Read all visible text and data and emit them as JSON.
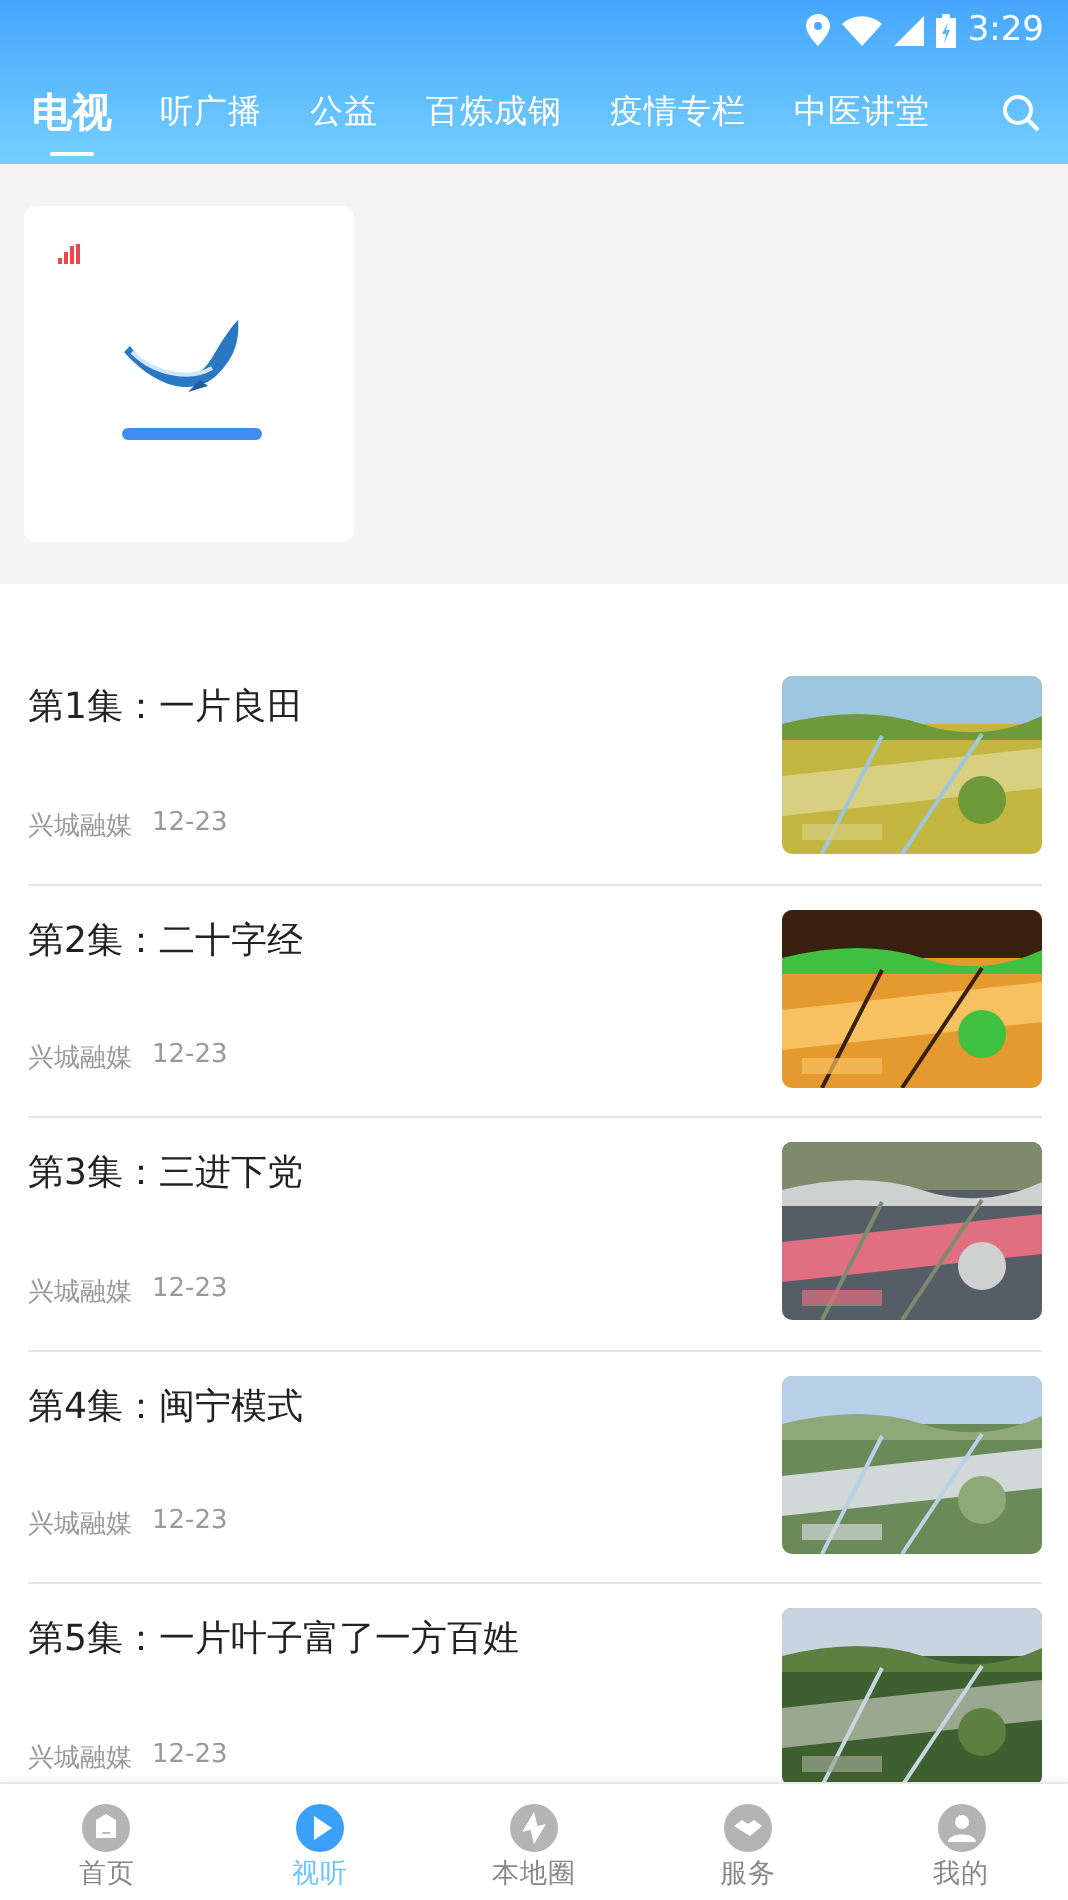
{
  "status_bar": {
    "time": "3:29"
  },
  "tabs": [
    {
      "label": "电视",
      "selected": true
    },
    {
      "label": "听广播",
      "selected": false
    },
    {
      "label": "公益",
      "selected": false
    },
    {
      "label": "百炼成钢",
      "selected": false
    },
    {
      "label": "疫情专栏",
      "selected": false
    },
    {
      "label": "中医讲堂",
      "selected": false
    }
  ],
  "channels": [
    {
      "kind": "picture",
      "live": true
    }
  ],
  "episodes": [
    {
      "title": "第1集：一片良田",
      "source": "兴城融媒",
      "date": "12-23"
    },
    {
      "title": "第2集：二十字经",
      "source": "兴城融媒",
      "date": "12-23"
    },
    {
      "title": "第3集：三进下党",
      "source": "兴城融媒",
      "date": "12-23"
    },
    {
      "title": "第4集：闽宁模式",
      "source": "兴城融媒",
      "date": "12-23"
    },
    {
      "title": "第5集：一片叶子富了一方百姓",
      "source": "兴城融媒",
      "date": "12-23"
    }
  ],
  "bottom_nav": [
    {
      "label": "首页",
      "selected": false
    },
    {
      "label": "视听",
      "selected": true
    },
    {
      "label": "本地圈",
      "selected": false
    },
    {
      "label": "服务",
      "selected": false
    },
    {
      "label": "我的",
      "selected": false
    }
  ]
}
